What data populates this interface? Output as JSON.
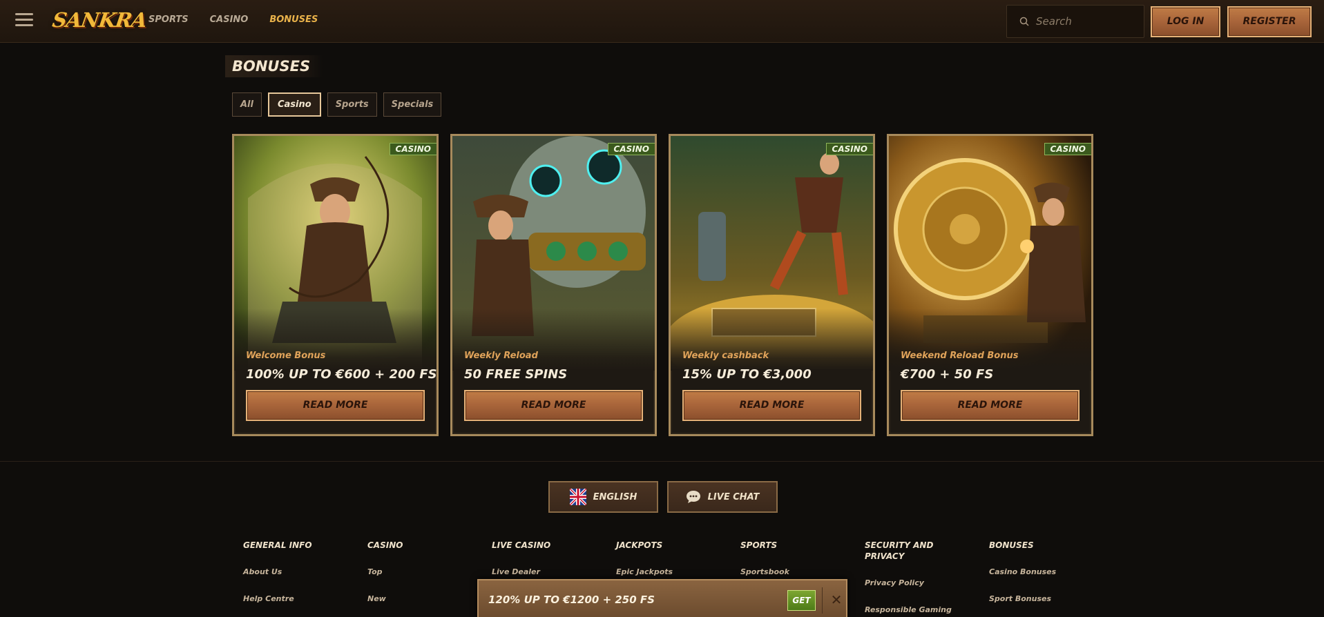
{
  "header": {
    "logo": "SANKRA",
    "nav": [
      {
        "label": "SPORTS"
      },
      {
        "label": "CASINO"
      },
      {
        "label": "BONUSES"
      }
    ],
    "search_placeholder": "Search",
    "login_label": "LOG IN",
    "register_label": "REGISTER"
  },
  "main": {
    "title": "BONUSES",
    "filters": [
      {
        "label": "All"
      },
      {
        "label": "Casino",
        "active": true
      },
      {
        "label": "Sports"
      },
      {
        "label": "Specials"
      }
    ],
    "cards": [
      {
        "badge": "CASINO",
        "subtitle": "Welcome Bonus",
        "headline": "100% UP TO €600 + 200 FS",
        "button": "READ MORE"
      },
      {
        "badge": "CASINO",
        "subtitle": "Weekly Reload",
        "headline": "50 FREE SPINS",
        "button": "READ MORE"
      },
      {
        "badge": "CASINO",
        "subtitle": "Weekly cashback",
        "headline": "15% UP TO €3,000",
        "button": "READ MORE"
      },
      {
        "badge": "CASINO",
        "subtitle": "Weekend Reload Bonus",
        "headline": "€700 + 50 FS",
        "button": "READ MORE"
      }
    ]
  },
  "footer": {
    "language_label": "ENGLISH",
    "chat_label": "LIVE CHAT",
    "columns": [
      {
        "title": "GENERAL INFO",
        "links": [
          "About Us",
          "Help Centre"
        ]
      },
      {
        "title": "CASINO",
        "links": [
          "Top",
          "New"
        ]
      },
      {
        "title": "LIVE CASINO",
        "links": [
          "Live Dealer"
        ]
      },
      {
        "title": "JACKPOTS",
        "links": [
          "Epic Jackpots"
        ]
      },
      {
        "title": "SPORTS",
        "links": [
          "Sportsbook"
        ]
      },
      {
        "title": "SECURITY AND PRIVACY",
        "links": [
          "Privacy Policy",
          "Responsible Gaming"
        ]
      },
      {
        "title": "BONUSES",
        "links": [
          "Casino Bonuses",
          "Sport Bonuses"
        ]
      }
    ]
  },
  "promo_bar": {
    "text": "120% UP TO €1200 + 250 FS",
    "get_label": "GET",
    "close_label": "✕"
  },
  "icons": {
    "menu": "hamburger-icon",
    "search": "search-icon",
    "flag": "uk-flag-icon",
    "chat": "chat-bubble-icon"
  }
}
